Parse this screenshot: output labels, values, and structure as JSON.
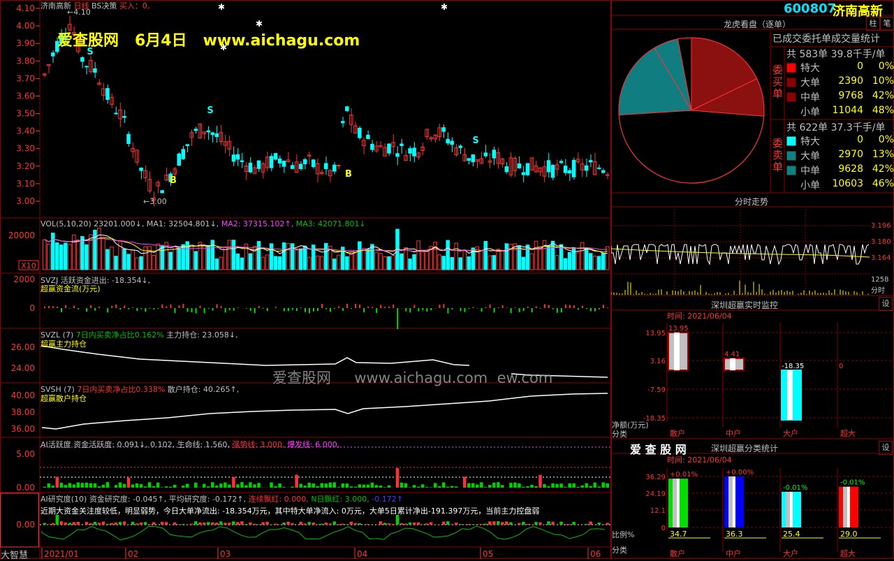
{
  "colors": {
    "up": "#ff3232",
    "down": "#00ffff",
    "grid": "#8b0000",
    "text": "#c0c0c0",
    "yellow": "#ffff00",
    "green": "#00c000",
    "magenta": "#ff40ff",
    "darkred": "#8b0a0a",
    "teal": "#107e80",
    "pieRed": "#a00000"
  },
  "watermark": {
    "top": "爱查股网   6月4日   www.aichagu.com",
    "center": "爱查股网     www.aichagu.com  ew.com"
  },
  "header": {
    "code": "600807",
    "name": "济南高新",
    "btn_pin": "柱",
    "btn_note": "笔"
  },
  "main_chart": {
    "title": "济南高新",
    "period": "日线",
    "indicator": "BS决策",
    "buy_label": "买入：",
    "buy_value": "0,",
    "y_ticks": [
      "4.10",
      "4.00",
      "3.90",
      "3.80",
      "3.70",
      "3.60",
      "3.50",
      "3.40",
      "3.30",
      "3.20",
      "3.10",
      "3.00"
    ],
    "high_label": "←4.10",
    "low_label": "←3.00",
    "signals": [
      {
        "text": "S"
      },
      {
        "text": "B"
      },
      {
        "text": "S"
      },
      {
        "text": "B"
      },
      {
        "text": "S"
      }
    ]
  },
  "volume": {
    "legend_name": "VOL(5,10,20)",
    "v": "23201.000↓,",
    "ma1": "MA1: 32504.801↓,",
    "ma2": "MA2: 37315.102↑,",
    "ma3": "MA3: 42071.801↓",
    "y_tick": "20000",
    "unit": "X10"
  },
  "svzj": {
    "name": "SVZJ",
    "text": "活跃资金进出: -18.354↓,",
    "sub": "超赢资金流(万元)",
    "y_ticks": [
      "2000",
      "0"
    ]
  },
  "svzl": {
    "name": "SVZL (7)",
    "text1": "7日内买卖净占比0.162%",
    "text2": "主力持仓: 23.058↓,",
    "sub": "超赢主力持仓",
    "y_ticks": [
      "26.00",
      "24.00"
    ]
  },
  "svsh": {
    "name": "SVSH (7)",
    "text1": "7日内买卖净占比0.338%",
    "text2": "散户持仓: 40.265↑,",
    "sub": "超赢散户持仓",
    "y_ticks": [
      "40.00",
      "38.00",
      "36.00"
    ]
  },
  "ai_active": {
    "name": "AI活跃度",
    "text": "资金活跃度: 0.091↓, 0.102, 生命线: 1.560,",
    "strong": "强势线: 3.000,",
    "burst": "爆发线: 6.000,",
    "y_ticks": [
      "5.00",
      "0.00"
    ]
  },
  "ai_research": {
    "name": "AI研究度(10)",
    "text": "资金研究度: -0.045↑, 平均研究度: -0.172↑,",
    "lian": "连续飘红: 0.000,",
    "nri": "N日飘红: 3.000,",
    "last": "-0.172↑",
    "comment": "近期大资金关注度较低，明显弱势，今日大单净流出: -18.354万元，其中特大单净流入: 0万元，大单5日累计净出-191.397万元，当前主力控盘弱",
    "y_ticks": [
      "0.00"
    ]
  },
  "bottom": {
    "corner": "大智慧",
    "axis": [
      "2021/01",
      "02",
      "03",
      "04",
      "05",
      "06"
    ]
  },
  "dragon": {
    "title": "龙虎看盘（逐单）",
    "subtitle": "已成交委托单成交量统计",
    "buy": {
      "side": "委买单",
      "total": "共 583单 39.8千手/单",
      "rows": [
        {
          "label": "特大",
          "vol": "0",
          "pct": "0%"
        },
        {
          "label": "大单",
          "vol": "2390",
          "pct": "10%"
        },
        {
          "label": "中单",
          "vol": "9768",
          "pct": "42%"
        },
        {
          "label": "小单",
          "vol": "11044",
          "pct": "48%"
        }
      ]
    },
    "sell": {
      "side": "委卖单",
      "total": "共 622单 37.3千手/单",
      "rows": [
        {
          "label": "特大",
          "vol": "0",
          "pct": "0%"
        },
        {
          "label": "大单",
          "vol": "2970",
          "pct": "13%"
        },
        {
          "label": "中单",
          "vol": "9628",
          "pct": "42%"
        },
        {
          "label": "小单",
          "vol": "10603",
          "pct": "46%"
        }
      ]
    }
  },
  "intraday": {
    "title": "分时走势",
    "prices": [
      "3.196",
      "3.180",
      "3.164"
    ],
    "vol": "1258",
    "unit": "分时"
  },
  "monitor": {
    "title": "深圳超赢实时监控",
    "btn": "设",
    "time": "时间: 2021/06/04",
    "y_ticks": [
      "13.95",
      "3.16",
      "-7.59",
      "-18.35"
    ],
    "ylabel": "净额(万元)",
    "xlabel": "分类",
    "bars": [
      {
        "name": "散户",
        "value": 13.95,
        "label": "13.95"
      },
      {
        "name": "中户",
        "value": 4.41,
        "label": "4.41"
      },
      {
        "name": "大户",
        "value": -18.35,
        "label": "-18.35"
      },
      {
        "name": "超大",
        "value": 0,
        "label": "0"
      }
    ]
  },
  "classify": {
    "logo": "爱 查 股 网",
    "title": "深圳超赢分类统计",
    "btn": "设",
    "time": "时间: 2021/06/04",
    "y_ticks": [
      "36.29",
      "24.19",
      "12.1",
      "0"
    ],
    "ylabel": "比例%",
    "xlabel": "分类",
    "bars": [
      {
        "name": "散户",
        "value": 34.7,
        "label": "34.7",
        "delta": "+0.01%"
      },
      {
        "name": "中户",
        "value": 36.3,
        "label": "36.3",
        "delta": "+0.00%"
      },
      {
        "name": "大户",
        "value": 25.4,
        "label": "25.4",
        "delta": "-0.01%"
      },
      {
        "name": "超大",
        "value": 29.0,
        "label": "29.0",
        "delta": "-0.01%"
      }
    ]
  }
}
